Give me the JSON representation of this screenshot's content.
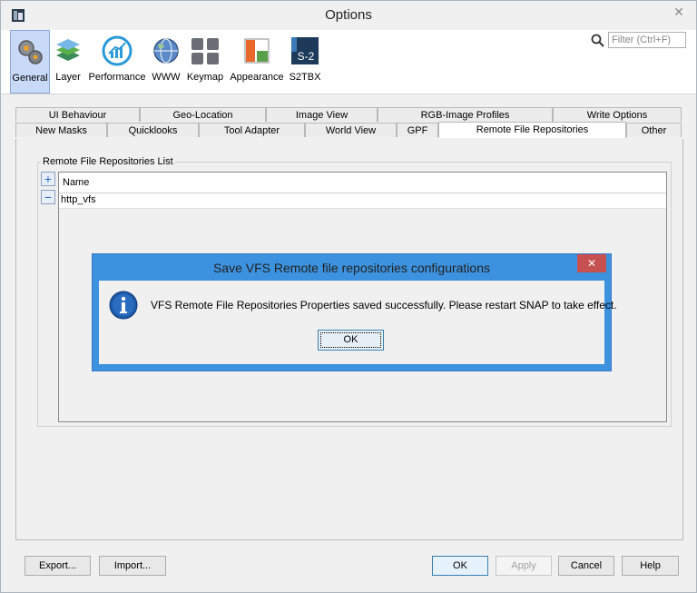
{
  "window": {
    "title": "Options"
  },
  "toolbar": {
    "categories": [
      {
        "label": "General",
        "icon": "gears-icon",
        "selected": true
      },
      {
        "label": "Layer",
        "icon": "layers-icon"
      },
      {
        "label": "Performance",
        "icon": "performance-chart-icon"
      },
      {
        "label": "WWW",
        "icon": "globe-icon"
      },
      {
        "label": "Keymap",
        "icon": "keyboard-icon"
      },
      {
        "label": "Appearance",
        "icon": "appearance-icon"
      },
      {
        "label": "S2TBX",
        "icon": "s2-snap-icon"
      }
    ],
    "search": {
      "placeholder": "Filter (Ctrl+F)"
    }
  },
  "tabs": {
    "row1": [
      "UI Behaviour",
      "Geo-Location",
      "Image View",
      "RGB-Image Profiles",
      "Write Options"
    ],
    "row2": [
      "New Masks",
      "Quicklooks",
      "Tool Adapter",
      "World View",
      "GPF",
      "Remote File Repositories",
      "Other"
    ],
    "active": "Remote File Repositories"
  },
  "repositories": {
    "group_title": "Remote File Repositories List",
    "add_symbol": "+",
    "remove_symbol": "−",
    "column_name": "Name",
    "rows": [
      "http_vfs"
    ]
  },
  "dialog": {
    "title": "Save VFS Remote file repositories configurations",
    "close_symbol": "✕",
    "message": "VFS Remote File Repositories Properties saved successfully. Please restart SNAP to take effect.",
    "ok_label": "OK"
  },
  "buttons": {
    "export": "Export...",
    "import": "Import...",
    "ok": "OK",
    "apply": "Apply",
    "cancel": "Cancel",
    "help": "Help"
  },
  "colors": {
    "dialog_frame": "#3c92de",
    "dialog_close": "#c75050",
    "selected_category": "#c8daf8"
  }
}
